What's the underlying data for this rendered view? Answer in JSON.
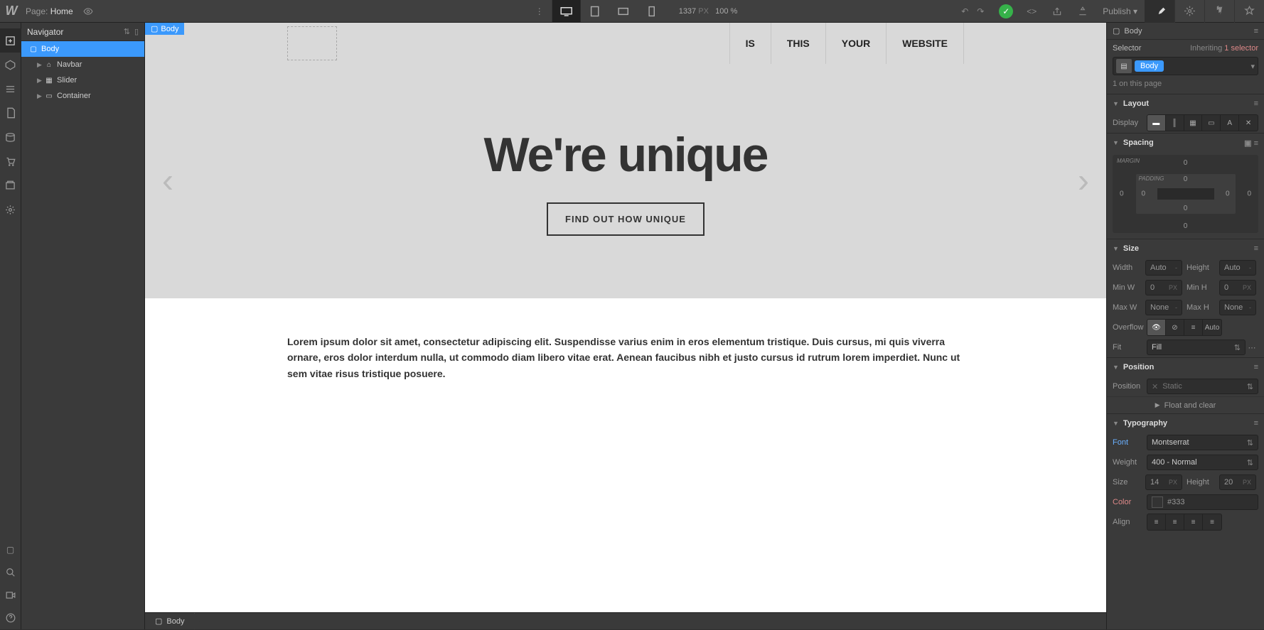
{
  "topbar": {
    "page_label": "Page:",
    "page_name": "Home",
    "width": "1337",
    "px": "PX",
    "zoom": "100 %",
    "publish": "Publish"
  },
  "navigator": {
    "title": "Navigator",
    "items": [
      {
        "label": "Body",
        "icon": "▢",
        "selected": true
      },
      {
        "label": "Navbar",
        "icon": "⌂",
        "child": true,
        "expandable": true
      },
      {
        "label": "Slider",
        "icon": "▦",
        "child": true,
        "expandable": true
      },
      {
        "label": "Container",
        "icon": "▭",
        "child": true,
        "expandable": true
      }
    ]
  },
  "canvas": {
    "sel_tag": "Body",
    "nav": [
      "IS",
      "THIS",
      "YOUR",
      "WEBSITE"
    ],
    "hero_title": "We're unique",
    "hero_cta": "FIND OUT HOW UNIQUE",
    "paragraph": "Lorem ipsum dolor sit amet, consectetur adipiscing elit. Suspendisse varius enim in eros elementum tristique. Duis cursus, mi quis viverra ornare, eros dolor interdum nulla, ut commodo diam libero vitae erat. Aenean faucibus nibh et justo cursus id rutrum lorem imperdiet. Nunc ut sem vitae risus tristique posuere."
  },
  "breadcrumb": "Body",
  "style": {
    "body_label": "Body",
    "selector_label": "Selector",
    "inheriting": "Inheriting",
    "inheriting_count": "1 selector",
    "sel_chip": "Body",
    "on_page": "1 on this page",
    "sections": {
      "layout": "Layout",
      "spacing": "Spacing",
      "size": "Size",
      "position": "Position",
      "typography": "Typography"
    },
    "display_label": "Display",
    "margin_label": "MARGIN",
    "padding_label": "PADDING",
    "spacing_vals": {
      "mt": "0",
      "mr": "0",
      "mb": "0",
      "ml": "0",
      "pt": "0",
      "pr": "0",
      "pb": "0",
      "pl": "0"
    },
    "width_label": "Width",
    "width_val": "Auto",
    "height_label": "Height",
    "height_val": "Auto",
    "minw_label": "Min W",
    "minw_val": "0",
    "minw_unit": "PX",
    "minh_label": "Min H",
    "minh_val": "0",
    "minh_unit": "PX",
    "maxw_label": "Max W",
    "maxw_val": "None",
    "maxh_label": "Max H",
    "maxh_val": "None",
    "overflow_label": "Overflow",
    "overflow_auto": "Auto",
    "fit_label": "Fit",
    "fit_val": "Fill",
    "position_label": "Position",
    "position_val": "Static",
    "float_label": "Float and clear",
    "font_label": "Font",
    "font_val": "Montserrat",
    "weight_label": "Weight",
    "weight_val": "400 - Normal",
    "size_label": "Size",
    "size_val": "14",
    "size_unit": "PX",
    "lineheight_label": "Height",
    "lineheight_val": "20",
    "lineheight_unit": "PX",
    "color_label": "Color",
    "color_val": "#333",
    "align_label": "Align"
  }
}
